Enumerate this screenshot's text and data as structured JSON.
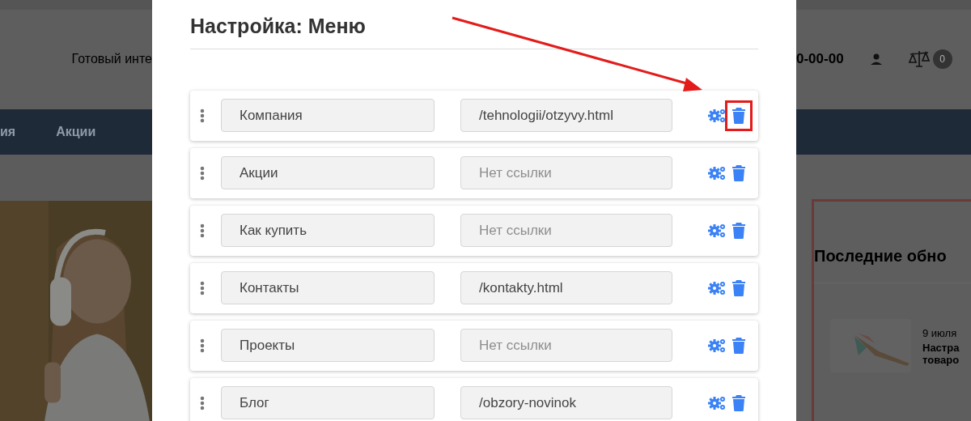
{
  "background": {
    "tagline": "Готовый инте",
    "nav": [
      "ия",
      "Акции"
    ],
    "phone": "0-00-00",
    "compare_count": "0",
    "sidebar": {
      "title": "Последние обно",
      "news": {
        "date": "9 июля",
        "title": "Настра\nтоваро"
      }
    }
  },
  "modal": {
    "title": "Настройка: Меню",
    "rows": [
      {
        "name": "Компания",
        "link": {
          "value": "/tehnologii/otzyvy.html"
        },
        "highlighted": true
      },
      {
        "name": "Акции",
        "link": {
          "placeholder": "Нет ссылки"
        },
        "highlighted": false
      },
      {
        "name": "Как купить",
        "link": {
          "placeholder": "Нет ссылки"
        },
        "highlighted": false
      },
      {
        "name": "Контакты",
        "link": {
          "value": "/kontakty.html"
        },
        "highlighted": false
      },
      {
        "name": "Проекты",
        "link": {
          "placeholder": "Нет ссылки"
        },
        "highlighted": false
      },
      {
        "name": "Блог",
        "link": {
          "value": "/obzory-novinok"
        },
        "highlighted": false
      }
    ]
  }
}
